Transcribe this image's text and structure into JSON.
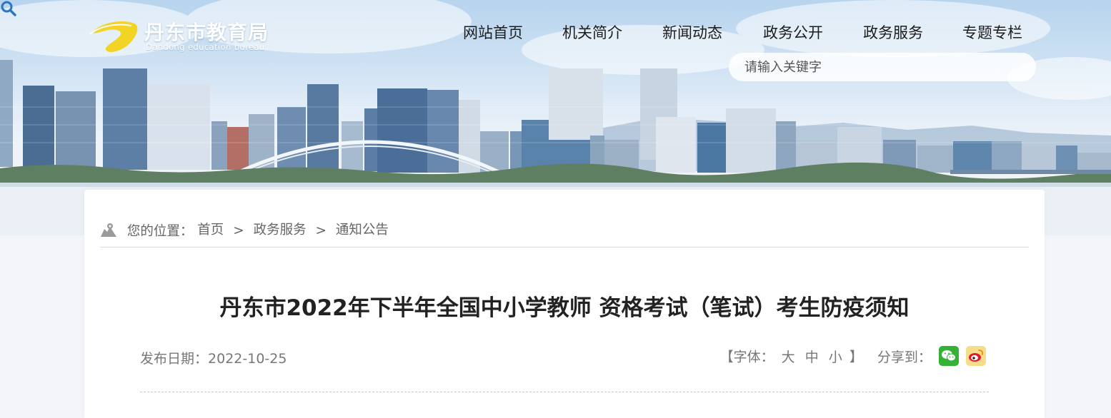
{
  "site": {
    "name_cn": "丹东市教育局",
    "name_en": "Dandong education bureau"
  },
  "nav": [
    {
      "label": "网站首页"
    },
    {
      "label": "机关简介"
    },
    {
      "label": "新闻动态"
    },
    {
      "label": "政务公开"
    },
    {
      "label": "政务服务"
    },
    {
      "label": "专题专栏"
    }
  ],
  "search": {
    "placeholder": "请输入关键字",
    "icon": "search-icon"
  },
  "breadcrumb": {
    "prefix": "您的位置：",
    "items": [
      "首页",
      "政务服务",
      "通知公告"
    ],
    "separator": ">",
    "icon": "map-icon"
  },
  "article": {
    "title": "丹东市2022年下半年全国中小学教师 资格考试（笔试）考生防疫须知",
    "date_label": "发布日期：",
    "date": "2022-10-25",
    "font_label": "【字体：",
    "font_sizes": [
      "大",
      "中",
      "小"
    ],
    "font_close": "】",
    "share_label": "分享到：",
    "share_icons": [
      "wechat-icon",
      "weibo-icon"
    ]
  },
  "colors": {
    "logo_yellow": "#f3d324",
    "wechat": "#35b236",
    "weibo": "#f6dd8c",
    "search_icon": "#2f74c0"
  }
}
